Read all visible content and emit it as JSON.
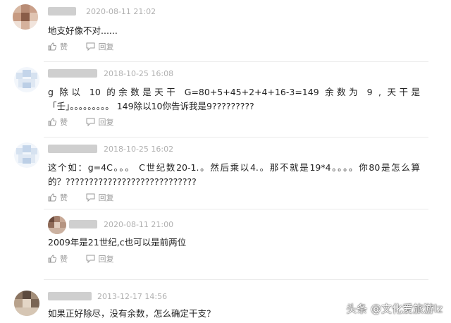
{
  "comments": [
    {
      "time": "2020-08-11 21:02",
      "text": "地支好像不对......",
      "like_label": "赞",
      "reply_label": "回复"
    },
    {
      "time": "2018-10-25 16:08",
      "text_line1": "g 除以 10 的余数是天干 G=80+5+45+2+4+16-3=149 余数为 9 , 天干是",
      "text_line2": "「壬」。。。。。。。。。  149除以10你告诉我是9?????????",
      "like_label": "赞",
      "reply_label": "回复"
    },
    {
      "time": "2018-10-25 16:02",
      "text_line1": "这个如：g=4C。。。 C世纪数20-1.。然后乘以4.。那不就是19*4。。。。你80是怎么算",
      "text_line2": "的？????????????????????????????",
      "like_label": "赞",
      "reply_label": "回复",
      "reply": {
        "time": "2020-08-11 21:00",
        "text": "2009年是21世纪,c也可以是前两位",
        "like_label": "赞",
        "reply_label": "回复"
      }
    },
    {
      "time": "2013-12-17 14:56",
      "text": "如果正好除尽，没有余数，怎么确定干支？"
    }
  ],
  "watermark": "头条 @文化爱旅游lz"
}
